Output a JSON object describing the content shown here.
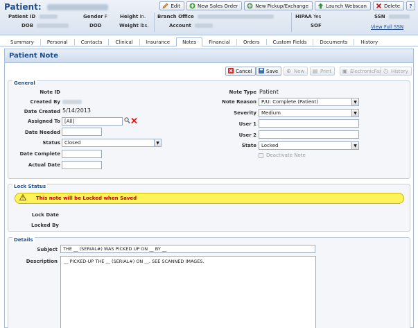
{
  "header": {
    "patient_label": "Patient:",
    "buttons": [
      {
        "label": "Edit",
        "icon": "pencil-icon"
      },
      {
        "label": "New Sales Order",
        "icon": "plus-icon"
      },
      {
        "label": "New Pickup/Exchange",
        "icon": "plus-icon"
      },
      {
        "label": "Launch Webscan",
        "icon": "upload-icon"
      },
      {
        "label": "Delete",
        "icon": "delete-icon"
      },
      {
        "label": "?",
        "icon": "help-icon"
      }
    ],
    "fields": {
      "patient_id": "Patient ID",
      "dob": "DOB",
      "gender": "Gender",
      "gender_value": "F",
      "dod": "DOD",
      "height": "Height",
      "height_unit": "in.",
      "weight": "Weight",
      "weight_unit": "lbs.",
      "branch_office": "Branch Office",
      "account": "Account",
      "hipaa": "HIPAA",
      "hipaa_value": "Yes",
      "sof": "SOF",
      "ssn": "SSN",
      "view_full_ssn": "View Full SSN"
    }
  },
  "tabs": [
    "Summary",
    "Personal",
    "Contacts",
    "Clinical",
    "Insurance",
    "Notes",
    "Financial",
    "Orders",
    "Custom Fields",
    "Documents",
    "History"
  ],
  "active_tab": "Notes",
  "panel": {
    "title": "Patient Note",
    "toolbar": {
      "cancel": "Cancel",
      "save": "Save",
      "new": "New",
      "print": "Print",
      "electronic_fax": "ElectronicFax",
      "history": "History"
    }
  },
  "general": {
    "legend": "General",
    "note_id_label": "Note ID",
    "created_by_label": "Created By",
    "date_created_label": "Date Created",
    "date_created": "5/14/2013",
    "assigned_to_label": "Assigned To",
    "assigned_to": "[All]",
    "date_needed_label": "Date Needed",
    "status_label": "Status",
    "status": "Closed",
    "date_complete_label": "Date Complete",
    "actual_date_label": "Actual Date",
    "note_type_label": "Note Type",
    "note_type": "Patient",
    "note_reason_label": "Note Reason",
    "note_reason": "P/U: Complete (Patient)",
    "severity_label": "Severity",
    "severity": "Medium",
    "user1_label": "User 1",
    "user2_label": "User 2",
    "state_label": "State",
    "state": "Locked",
    "deactivate_label": "Deactivate Note"
  },
  "lock_status": {
    "legend": "Lock Status",
    "warning": "This note will be Locked when Saved",
    "lock_date_label": "Lock Date",
    "locked_by_label": "Locked By"
  },
  "details": {
    "legend": "Details",
    "subject_label": "Subject",
    "subject": "THE __ (SERIAL#) WAS PICKED UP ON __ BY __",
    "description_label": "Description",
    "description": "__ PICKED-UP THE __ (SERIAL#) ON __.  SEE SCANNED IMAGES."
  },
  "colors": {
    "accent": "#1f4f8f",
    "warning_bg": "#fff35c",
    "warning_text": "#c40000"
  }
}
